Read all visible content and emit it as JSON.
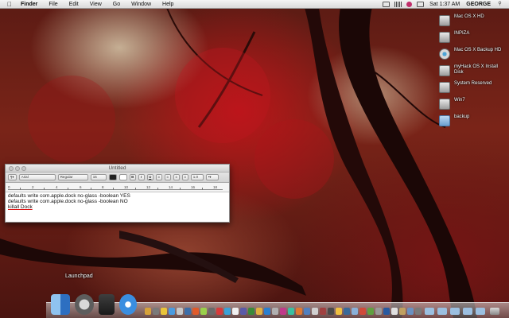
{
  "menubar": {
    "apple": "",
    "items": [
      "Finder",
      "File",
      "Edit",
      "View",
      "Go",
      "Window",
      "Help"
    ],
    "clock": "Sat 1:37 AM",
    "user": "GEORGE",
    "status_icons": [
      "wifi-icon",
      "bluetooth-icon",
      "volume-icon",
      "battery-icon",
      "spotlight-icon"
    ]
  },
  "desktop": {
    "drives": [
      {
        "label": "Mac OS X HD",
        "icon": "hard-drive-icon"
      },
      {
        "label": "INPIZA",
        "icon": "hard-drive-icon"
      },
      {
        "label": "Mac OS X Backup HD",
        "icon": "backup-drive-icon"
      },
      {
        "label": "myHack OS X Install Disk",
        "icon": "hard-drive-icon"
      },
      {
        "label": "System Reserved",
        "icon": "hard-drive-icon"
      },
      {
        "label": "Win7",
        "icon": "hard-drive-icon"
      },
      {
        "label": "backup",
        "icon": "folder-icon"
      }
    ]
  },
  "textedit": {
    "title": "Untitled",
    "font_family": "Arial",
    "font_style": "Regular",
    "font_size": "15",
    "spacing": "1.0",
    "bold": "B",
    "italic": "I",
    "underline": "U",
    "ruler_marks": [
      "0",
      "2",
      "4",
      "6",
      "8",
      "10",
      "12",
      "14",
      "16",
      "18"
    ],
    "lines": [
      "defaults write com.apple.dock no-glass -boolean YES",
      "defaults write com.apple.dock no-glass -boolean NO",
      "killall Dock"
    ]
  },
  "dock": {
    "tooltip": "Launchpad",
    "apps": [
      "finder-icon",
      "launchpad-icon",
      "dashboard-icon",
      "safari-icon"
    ]
  }
}
